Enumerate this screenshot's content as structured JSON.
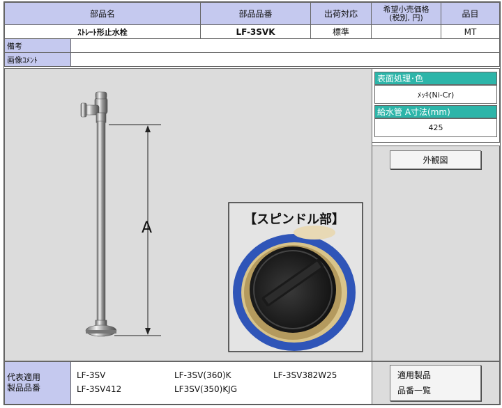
{
  "header": {
    "part_name_label": "部品名",
    "part_number_label": "部品品番",
    "shipping_label": "出荷対応",
    "price_label_line1": "希望小売価格",
    "price_label_line2": "(税別, 円)",
    "category_label": "品目"
  },
  "row": {
    "part_name": "ｽﾄﾚｰﾄ形止水栓",
    "part_number": "LF-3SVK",
    "shipping": "標準",
    "price": "",
    "category": "MT"
  },
  "notes": {
    "label": "備考",
    "value": ""
  },
  "image_comment": {
    "label": "画像ｺﾒﾝﾄ",
    "value": ""
  },
  "right_panel": {
    "finish_label": "表面処理･色",
    "finish_value": "ﾒｯｷ(Ni-Cr)",
    "pipe_label": "給水管 A寸法(mm)",
    "pipe_value": "425",
    "exterior_button": "外観図"
  },
  "figure": {
    "dimension_label": "A",
    "spindle_caption": "【スピンドル部】"
  },
  "products": {
    "label_line1": "代表適用",
    "label_line2": "製品品番",
    "items": [
      "LF-3SV",
      "LF-3SV(360)K",
      "LF-3SV382W25",
      "LF-3SV412",
      "LF3SV(350)KJG"
    ],
    "list_button_line1": "適用製品",
    "list_button_line2": "品番一覧"
  },
  "colors": {
    "header_bg": "#c5c9ef",
    "teal": "#2db5a9",
    "panel_gray": "#dcdcdc"
  }
}
